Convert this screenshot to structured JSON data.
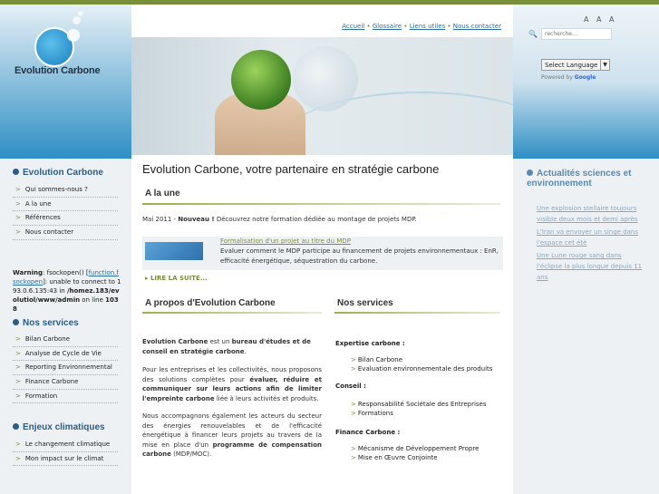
{
  "logo": {
    "text": "Evolution Carbone"
  },
  "topnav": {
    "items": [
      "Accueil",
      "Glossaire",
      "Liens utiles",
      "Nous contacter"
    ],
    "sep": "•"
  },
  "font_size_controls": "A A A",
  "search": {
    "placeholder": "recherche..."
  },
  "translate": {
    "select": "Select Language",
    "powered_prefix": "Powered by",
    "powered_brand": "Google"
  },
  "left": {
    "section1": {
      "title": "Evolution Carbone",
      "items": [
        "Qui sommes-nous ?",
        "A la une",
        "Références",
        "Nous contacter"
      ]
    },
    "warning": {
      "label": "Warning",
      "pre": ": fsockopen() [",
      "link": "function.fsockopen",
      "post": "]: unable to connect to 193.0.6.135:43 in ",
      "path": "/homez.183/evolutiol/www/admin",
      "line_pre": " on line ",
      "line": "1038"
    },
    "section2": {
      "title": "Nos services",
      "items": [
        "Bilan Carbone",
        "Analyse de Cycle de Vie",
        "Reporting Environnemental",
        "Finance Carbone",
        "Formation"
      ]
    },
    "section3": {
      "title": "Enjeux climatiques",
      "items": [
        "Le changement climatique",
        "Mon impact sur le climat"
      ]
    },
    "bullet_glyph": ">"
  },
  "main": {
    "title": "Evolution Carbone, votre partenaire en stratégie carbone",
    "une": {
      "title": "A la une",
      "date": "Mai 2011 - ",
      "new": "Nouveau !",
      "text": " Découvrez notre formation dédiée au montage de projets MDP."
    },
    "news": {
      "title": "Formalisation d'un projet au titre du MDP",
      "desc": "Evaluer comment le MDP participe au financement de projets environnementaux : EnR, efficacité énergétique, séquestration du carbone."
    },
    "readmore": "▸ LIRE LA SUITE...",
    "apropos": {
      "title": "A propos d'Evolution Carbone",
      "p1_b1": "Evolution Carbone",
      "p1_t1": " est un ",
      "p1_b2": "bureau d'études et de conseil en stratégie carbone",
      ".": ".",
      "p2_t1": "Pour les entreprises et les collectivités, nous proposons des solutions complètes pour ",
      "p2_b1": "évaluer, réduire et communiquer sur leurs actions afin de limiter l'empreinte carbone",
      "p2_t2": " liée à leurs activités et produits.",
      "p3_t1": "Nous accompagnons également les acteurs du secteur des énergies renouvelables et de l'efficacité énergétique à financer leurs projets au travers de la mise en place d'un ",
      "p3_b1": "programme de compensation carbone",
      "p3_t2": " (MDP/MOC)."
    },
    "services": {
      "title": "Nos services",
      "groups": [
        {
          "cat": "Expertise carbone :",
          "items": [
            "Bilan Carbone",
            "Evaluation environnementale des produits"
          ]
        },
        {
          "cat": "Conseil :",
          "items": [
            "Responsabilité Sociétale des Entreprises",
            "Formations"
          ]
        },
        {
          "cat": "Finance Carbone :",
          "items": [
            "Mécanisme de Développement Propre",
            "Mise en Œuvre Conjointe"
          ]
        }
      ]
    }
  },
  "right": {
    "title": "Actualités sciences et environnement",
    "links": [
      "Une explosion stellaire toujours visible deux mois et demi après",
      "L'Iran va envoyer un singe dans l'espace cet été",
      "Une Lune rouge sang dans l'éclipse la plus longue depuis 11 ans"
    ]
  }
}
